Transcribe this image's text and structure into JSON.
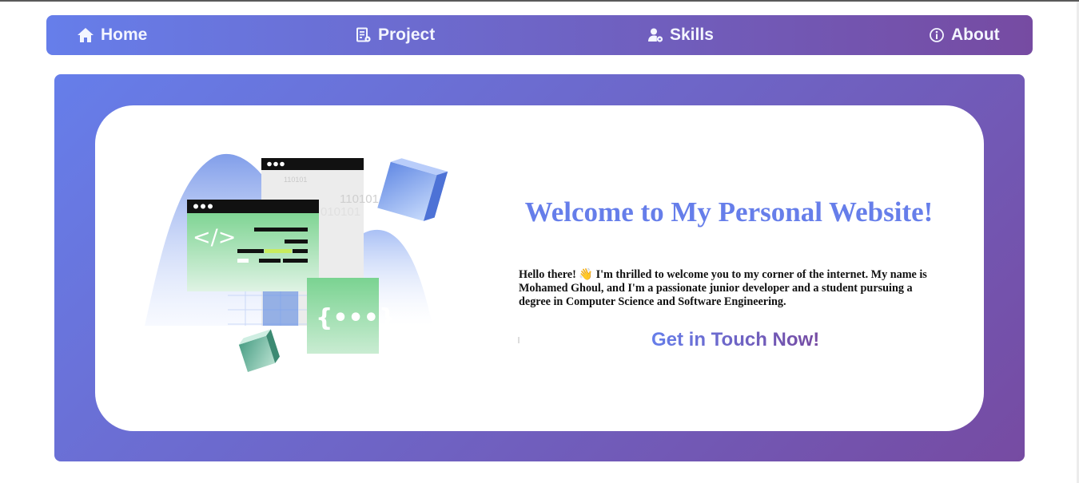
{
  "nav": {
    "home": "Home",
    "project": "Project",
    "skills": "Skills",
    "about": "About"
  },
  "hero": {
    "title": "Welcome to My Personal Website!",
    "intro": "Hello there! 👋 I'm thrilled to welcome you to my corner of the internet. My name is Mohamed Ghoul, and I'm a passionate junior developer and a student pursuing a degree in Computer Science and Software Engineering.",
    "cta": "Get in Touch Now!"
  },
  "illustration": {
    "binary_line_1": "110101",
    "binary_line_2": "010101",
    "binary_small": "110101",
    "code_glyph": "</>",
    "api_glyph": "{•••}"
  },
  "colors": {
    "gradient_start": "#667eea",
    "gradient_end": "#764ba2",
    "title": "#667eea"
  }
}
